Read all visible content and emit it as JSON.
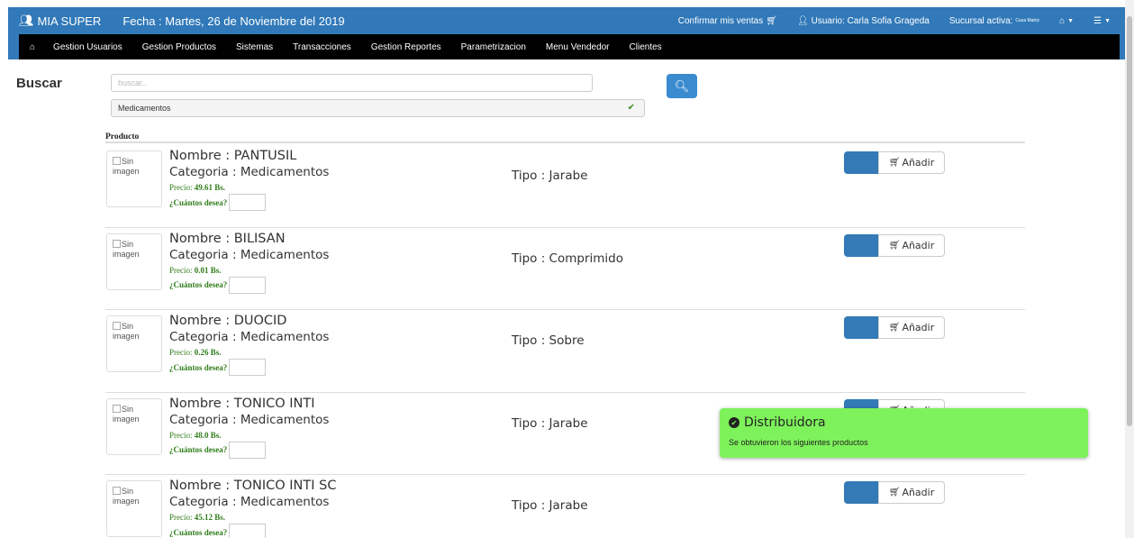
{
  "header": {
    "brand": "MIA SUPER",
    "date": "Fecha : Martes, 26 de Noviembre del 2019",
    "confirm_sales": "Confirmar mis ventas",
    "user": "Usuario: Carla Sofia Grageda",
    "branch_label": "Sucursal activa:",
    "branch_value": "Casa Matriz"
  },
  "nav": {
    "items": [
      "Gestion Usuarios",
      "Gestion Productos",
      "Sistemas",
      "Transacciones",
      "Gestion Reportes",
      "Parametrizacion",
      "Menu Vendedor",
      "Clientes"
    ]
  },
  "search": {
    "label": "Buscar",
    "placeholder": "buscar..",
    "category_selected": "Medicamentos"
  },
  "table": {
    "header": "Producto",
    "image_alt_1": "Sin",
    "image_alt_2": "imagen",
    "name_prefix": "Nombre : ",
    "category_prefix": "Categoria : ",
    "price_prefix": "Precio: ",
    "qty_label": "¿Cuántos desea?",
    "type_prefix": "Tipo : ",
    "add_label": "Añadir",
    "rows": [
      {
        "name": "PANTUSIL",
        "category": "Medicamentos",
        "price": "49.61 Bs.",
        "type": "Jarabe"
      },
      {
        "name": "BILISAN",
        "category": "Medicamentos",
        "price": "0.01 Bs.",
        "type": "Comprimido"
      },
      {
        "name": "DUOCID",
        "category": "Medicamentos",
        "price": "0.26 Bs.",
        "type": "Sobre"
      },
      {
        "name": "TONICO INTI",
        "category": "Medicamentos",
        "price": "48.0 Bs.",
        "type": "Jarabe"
      },
      {
        "name": "TONICO INTI SC",
        "category": "Medicamentos",
        "price": "45.12 Bs.",
        "type": "Jarabe"
      }
    ]
  },
  "toast": {
    "title": "Distribuidora",
    "message": "Se obtuvieron los siguientes productos"
  },
  "colors": {
    "header_blue": "#3179b9",
    "nav_black": "#000000",
    "toast_green": "#7ef25b",
    "price_green": "#2f7d1a"
  }
}
